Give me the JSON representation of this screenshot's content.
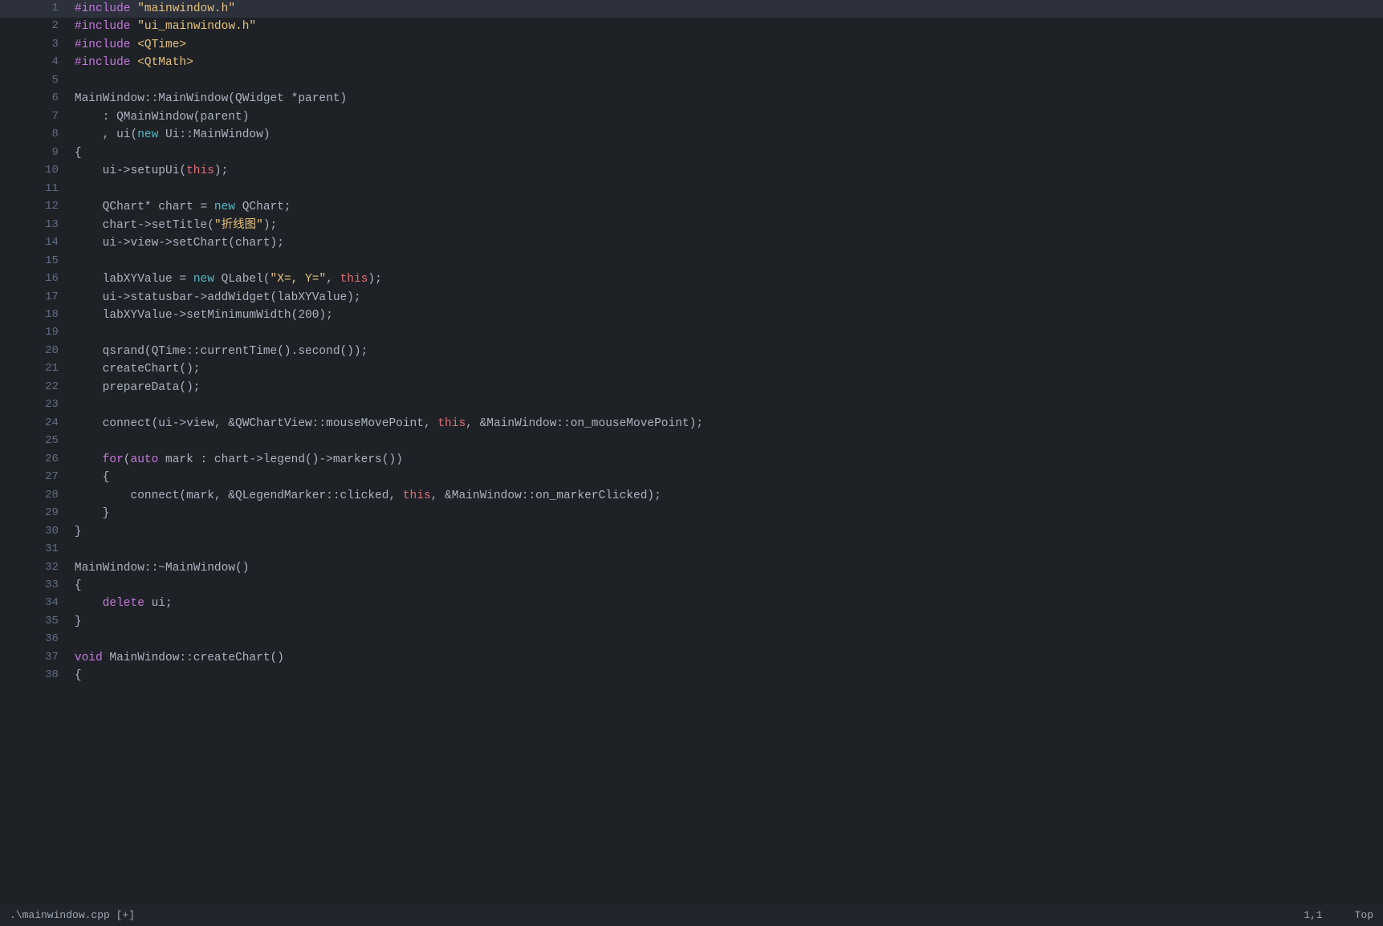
{
  "status_bar": {
    "filename": ".\\mainwindow.cpp [+]",
    "position": "1,1",
    "scroll": "Top"
  },
  "lines": [
    {
      "num": 1,
      "tokens": [
        {
          "cls": "kw-include",
          "t": "#include"
        },
        {
          "cls": "plain",
          "t": " "
        },
        {
          "cls": "kw-string",
          "t": "\"mainwindow.h\""
        }
      ]
    },
    {
      "num": 2,
      "tokens": [
        {
          "cls": "kw-include",
          "t": "#include"
        },
        {
          "cls": "plain",
          "t": " "
        },
        {
          "cls": "kw-string",
          "t": "\"ui_mainwindow.h\""
        }
      ]
    },
    {
      "num": 3,
      "tokens": [
        {
          "cls": "kw-include",
          "t": "#include"
        },
        {
          "cls": "plain",
          "t": " "
        },
        {
          "cls": "kw-angle",
          "t": "<QTime>"
        }
      ]
    },
    {
      "num": 4,
      "tokens": [
        {
          "cls": "kw-include",
          "t": "#include"
        },
        {
          "cls": "plain",
          "t": " "
        },
        {
          "cls": "kw-angle",
          "t": "<QtMath>"
        }
      ]
    },
    {
      "num": 5,
      "tokens": []
    },
    {
      "num": 6,
      "tokens": [
        {
          "cls": "plain",
          "t": "MainWindow::MainWindow(QWidget *parent)"
        }
      ]
    },
    {
      "num": 7,
      "tokens": [
        {
          "cls": "plain",
          "t": "    : QMainWindow(parent)"
        }
      ]
    },
    {
      "num": 8,
      "tokens": [
        {
          "cls": "plain",
          "t": "    , ui("
        },
        {
          "cls": "kw-new",
          "t": "new"
        },
        {
          "cls": "plain",
          "t": " Ui::MainWindow)"
        }
      ]
    },
    {
      "num": 9,
      "tokens": [
        {
          "cls": "plain",
          "t": "{"
        }
      ]
    },
    {
      "num": 10,
      "tokens": [
        {
          "cls": "plain",
          "t": "    ui->setupUi("
        },
        {
          "cls": "kw-this",
          "t": "this"
        },
        {
          "cls": "plain",
          "t": ");"
        }
      ]
    },
    {
      "num": 11,
      "tokens": []
    },
    {
      "num": 12,
      "tokens": [
        {
          "cls": "plain",
          "t": "    QChart* chart = "
        },
        {
          "cls": "kw-new",
          "t": "new"
        },
        {
          "cls": "plain",
          "t": " QChart;"
        }
      ]
    },
    {
      "num": 13,
      "tokens": [
        {
          "cls": "plain",
          "t": "    chart->setTitle("
        },
        {
          "cls": "kw-string",
          "t": "\"折线图\""
        },
        {
          "cls": "plain",
          "t": ");"
        }
      ]
    },
    {
      "num": 14,
      "tokens": [
        {
          "cls": "plain",
          "t": "    ui->view->setChart(chart);"
        }
      ]
    },
    {
      "num": 15,
      "tokens": []
    },
    {
      "num": 16,
      "tokens": [
        {
          "cls": "plain",
          "t": "    labXYValue = "
        },
        {
          "cls": "kw-new",
          "t": "new"
        },
        {
          "cls": "plain",
          "t": " QLabel("
        },
        {
          "cls": "kw-string",
          "t": "\"X=, Y=\""
        },
        {
          "cls": "plain",
          "t": ", "
        },
        {
          "cls": "kw-this",
          "t": "this"
        },
        {
          "cls": "plain",
          "t": ");"
        }
      ]
    },
    {
      "num": 17,
      "tokens": [
        {
          "cls": "plain",
          "t": "    ui->statusbar->addWidget(labXYValue);"
        }
      ]
    },
    {
      "num": 18,
      "tokens": [
        {
          "cls": "plain",
          "t": "    labXYValue->setMinimumWidth(200);"
        }
      ]
    },
    {
      "num": 19,
      "tokens": []
    },
    {
      "num": 20,
      "tokens": [
        {
          "cls": "plain",
          "t": "    qsrand(QTime::currentTime().second());"
        }
      ]
    },
    {
      "num": 21,
      "tokens": [
        {
          "cls": "plain",
          "t": "    createChart();"
        }
      ]
    },
    {
      "num": 22,
      "tokens": [
        {
          "cls": "plain",
          "t": "    prepareData();"
        }
      ]
    },
    {
      "num": 23,
      "tokens": []
    },
    {
      "num": 24,
      "tokens": [
        {
          "cls": "plain",
          "t": "    connect(ui->view, &QWChartView::mouseMovePoint, "
        },
        {
          "cls": "kw-this",
          "t": "this"
        },
        {
          "cls": "plain",
          "t": ", &MainWindow::on_mouseMovePoint);"
        }
      ]
    },
    {
      "num": 25,
      "tokens": []
    },
    {
      "num": 26,
      "tokens": [
        {
          "cls": "kw-type",
          "t": "    for"
        },
        {
          "cls": "plain",
          "t": "("
        },
        {
          "cls": "kw-auto",
          "t": "auto"
        },
        {
          "cls": "plain",
          "t": " mark : chart->legend()->markers())"
        }
      ]
    },
    {
      "num": 27,
      "tokens": [
        {
          "cls": "plain",
          "t": "    {"
        }
      ]
    },
    {
      "num": 28,
      "tokens": [
        {
          "cls": "plain",
          "t": "        connect(mark, &QLegendMarker::clicked, "
        },
        {
          "cls": "kw-this",
          "t": "this"
        },
        {
          "cls": "plain",
          "t": ", &MainWindow::on_markerClicked);"
        }
      ]
    },
    {
      "num": 29,
      "tokens": [
        {
          "cls": "plain",
          "t": "    }"
        }
      ]
    },
    {
      "num": 30,
      "tokens": [
        {
          "cls": "plain",
          "t": "}"
        }
      ]
    },
    {
      "num": 31,
      "tokens": []
    },
    {
      "num": 32,
      "tokens": [
        {
          "cls": "plain",
          "t": "MainWindow::~MainWindow()"
        }
      ]
    },
    {
      "num": 33,
      "tokens": [
        {
          "cls": "plain",
          "t": "{"
        }
      ]
    },
    {
      "num": 34,
      "tokens": [
        {
          "cls": "kw-type",
          "t": "    delete"
        },
        {
          "cls": "plain",
          "t": " ui;"
        }
      ]
    },
    {
      "num": 35,
      "tokens": [
        {
          "cls": "plain",
          "t": "}"
        }
      ]
    },
    {
      "num": 36,
      "tokens": []
    },
    {
      "num": 37,
      "tokens": [
        {
          "cls": "kw-type",
          "t": "void"
        },
        {
          "cls": "plain",
          "t": " MainWindow::createChart()"
        }
      ]
    },
    {
      "num": 38,
      "tokens": [
        {
          "cls": "plain",
          "t": "{"
        }
      ]
    }
  ]
}
